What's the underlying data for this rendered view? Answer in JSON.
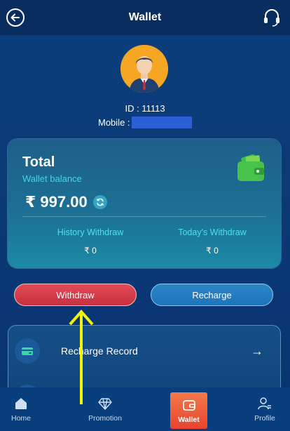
{
  "header": {
    "title": "Wallet"
  },
  "profile": {
    "id": "ID : 11113",
    "mobile_label": "Mobile :"
  },
  "card": {
    "total": "Total",
    "sub": "Wallet balance",
    "balance": "₹ 997.00",
    "history_label": "History Withdraw",
    "history_value": "₹ 0",
    "today_label": "Today's Withdraw",
    "today_value": "₹ 0"
  },
  "actions": {
    "withdraw": "Withdraw",
    "recharge": "Recharge"
  },
  "records": {
    "recharge_record": "Recharge Record"
  },
  "nav": {
    "home": "Home",
    "promotion": "Promotion",
    "wallet": "Wallet",
    "profile": "Profile"
  },
  "colors": {
    "accent_cyan": "#43d6e6",
    "withdraw_red": "#d43a48",
    "recharge_blue": "#2580c2",
    "wallet_tab": "#ef5a3c"
  }
}
